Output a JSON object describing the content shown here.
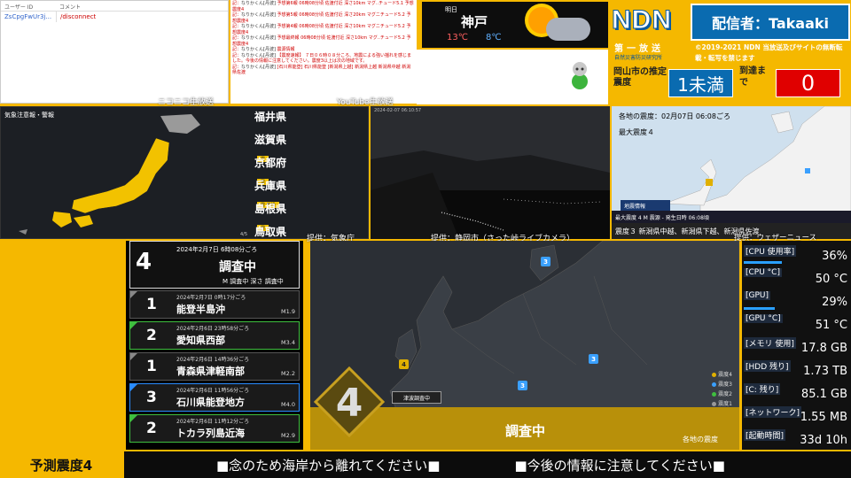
{
  "comments": {
    "header_user": "ユーザー ID",
    "header_comment": "コメント",
    "rows": [
      {
        "user": "ZsCpgFwUr3j...",
        "comment": "/disconnect"
      }
    ]
  },
  "log": {
    "lines": [
      {
        "who": "なりかくん[丹波]",
        "text": "予想第6報 06時08分頃 佐渡付近 深さ10km マグ..チュード5.1 予想震度4"
      },
      {
        "who": "なりかくん[丹波]",
        "text": "予想第5報 06時08分頃 佐渡付近 深さ20km マグニチュード5.2 予想震度4"
      },
      {
        "who": "なりかくん[丹波]",
        "text": "予想第4報 06時08分頃 佐渡付近 深さ10km マグニチュード5.2 予想震度4"
      },
      {
        "who": "なりかくん[丹波]",
        "text": "予想最終報 06時08分頃 佐渡付近 深さ10km マグ..チュード5.2 予想震度4"
      },
      {
        "who": "なりかくん[丹波]",
        "text": "震源情報"
      },
      {
        "who": "なりかくん[丹波]",
        "text": "【震度速報】 ７日０６時０８分ころ、地震による強い揺れを感じました。今後の情報に注意してください。震度3以上は次の地域です。"
      },
      {
        "who": "なりかくん[丹波]",
        "text": "[石川県能登] 石川県能登 [新潟県上越] 新潟県上越 新潟県中越 新潟県佐渡"
      }
    ]
  },
  "weather": {
    "day": "明日",
    "city": "神戸",
    "high": "13℃",
    "low": "8℃",
    "icon": "sun-cloud-icon"
  },
  "brand": {
    "logo": "NDN",
    "distributor": "配信者：Takaaki",
    "sub1": "第一放送",
    "sub2": "自然災害防災研究所",
    "copyright": "©2019-2021 NDN 当放送及びサイトの無断転載・転写を禁じます",
    "intensity_label": "岡山市の推定震度",
    "intensity_value": "1未満",
    "arrival_label": "到達まで",
    "arrival_value": "0"
  },
  "panels": {
    "jma_title": "気象注意報・警報",
    "jma_page": "4/5",
    "prefectures": [
      {
        "name": "福井県",
        "tag": ""
      },
      {
        "name": "滋賀県",
        "tag": "雷"
      },
      {
        "name": "京都府",
        "tag": "雷"
      },
      {
        "name": "兵庫県",
        "tag": "雷 乾燥"
      },
      {
        "name": "島根県",
        "tag": "雷"
      },
      {
        "name": "鳥取県",
        "tag": "雷"
      }
    ],
    "cam_stamp": "2024-02-07 06:10:57",
    "map_time": "各地の震度：02月07日 06:08ごろ",
    "map_max": "最大震度４",
    "map_info_tag": "地震情報",
    "map_info": "最大震度 4  M  震源 -  発生日時 06:08頃",
    "map_info2": "震度３  新潟県中越、新潟県下越、新潟県佐渡",
    "credits": [
      "ニコニコ生放送",
      "YouTube生放送",
      "提供：気象庁",
      "提供：静岡市（さった峠ライブカメラ）",
      "提供：ウェザーニュース"
    ]
  },
  "eq": {
    "latest": {
      "intensity": "4",
      "datetime": "2024年2月7日 6時08分ごろ",
      "status": "調査中",
      "detail": "M 調査中  深さ 調査中"
    },
    "items": [
      {
        "intensity": "1",
        "datetime": "2024年2月7日 0時17分ごろ",
        "place": "能登半島沖",
        "mag": "M1.9",
        "color": "#888888"
      },
      {
        "intensity": "2",
        "datetime": "2024年2月6日 23時58分ごろ",
        "place": "愛知県西部",
        "mag": "M3.4",
        "color": "#3fbf3f"
      },
      {
        "intensity": "1",
        "datetime": "2024年2月6日 14時36分ごろ",
        "place": "青森県津軽南部",
        "mag": "M2.2",
        "color": "#888888"
      },
      {
        "intensity": "3",
        "datetime": "2024年2月6日 11時56分ごろ",
        "place": "石川県能登地方",
        "mag": "M4.0",
        "color": "#2a8cff"
      },
      {
        "intensity": "2",
        "datetime": "2024年2月6日 11時12分ごろ",
        "place": "トカラ列島近海",
        "mag": "M2.9",
        "color": "#3fbf3f"
      }
    ]
  },
  "bigmap": {
    "legend": [
      "震度4",
      "震度3",
      "震度2",
      "震度1"
    ],
    "tsunami": "津波調査中",
    "intensity": "4",
    "status": "調査中",
    "footer": "各地の震度"
  },
  "stats": [
    {
      "label": "[CPU 使用率]",
      "value": "36%",
      "fill": 0.36
    },
    {
      "label": "[CPU °C]",
      "value": "50 °C",
      "fill": 0.0
    },
    {
      "label": "[GPU]",
      "value": "29%",
      "fill": 0.29
    },
    {
      "label": "[GPU °C]",
      "value": "51 °C",
      "fill": 0.0
    },
    {
      "label": "[メモリ 使用]",
      "value": "17.8 GB",
      "fill": 0.0
    },
    {
      "label": "[HDD 残り]",
      "value": "1.73 TB",
      "fill": 0.0
    },
    {
      "label": "[C: 残り]",
      "value": "85.1 GB",
      "fill": 0.0
    },
    {
      "label": "[ネットワーク]",
      "value": "1.55 MB",
      "fill": 0.0
    },
    {
      "label": "[起動時間]",
      "value": "33d 10h",
      "fill": 0.0
    }
  ],
  "ticker": {
    "label": "予測震度4",
    "messages": [
      "■念のため海岸から離れてください■",
      "■今後の情報に注意してください■"
    ]
  }
}
